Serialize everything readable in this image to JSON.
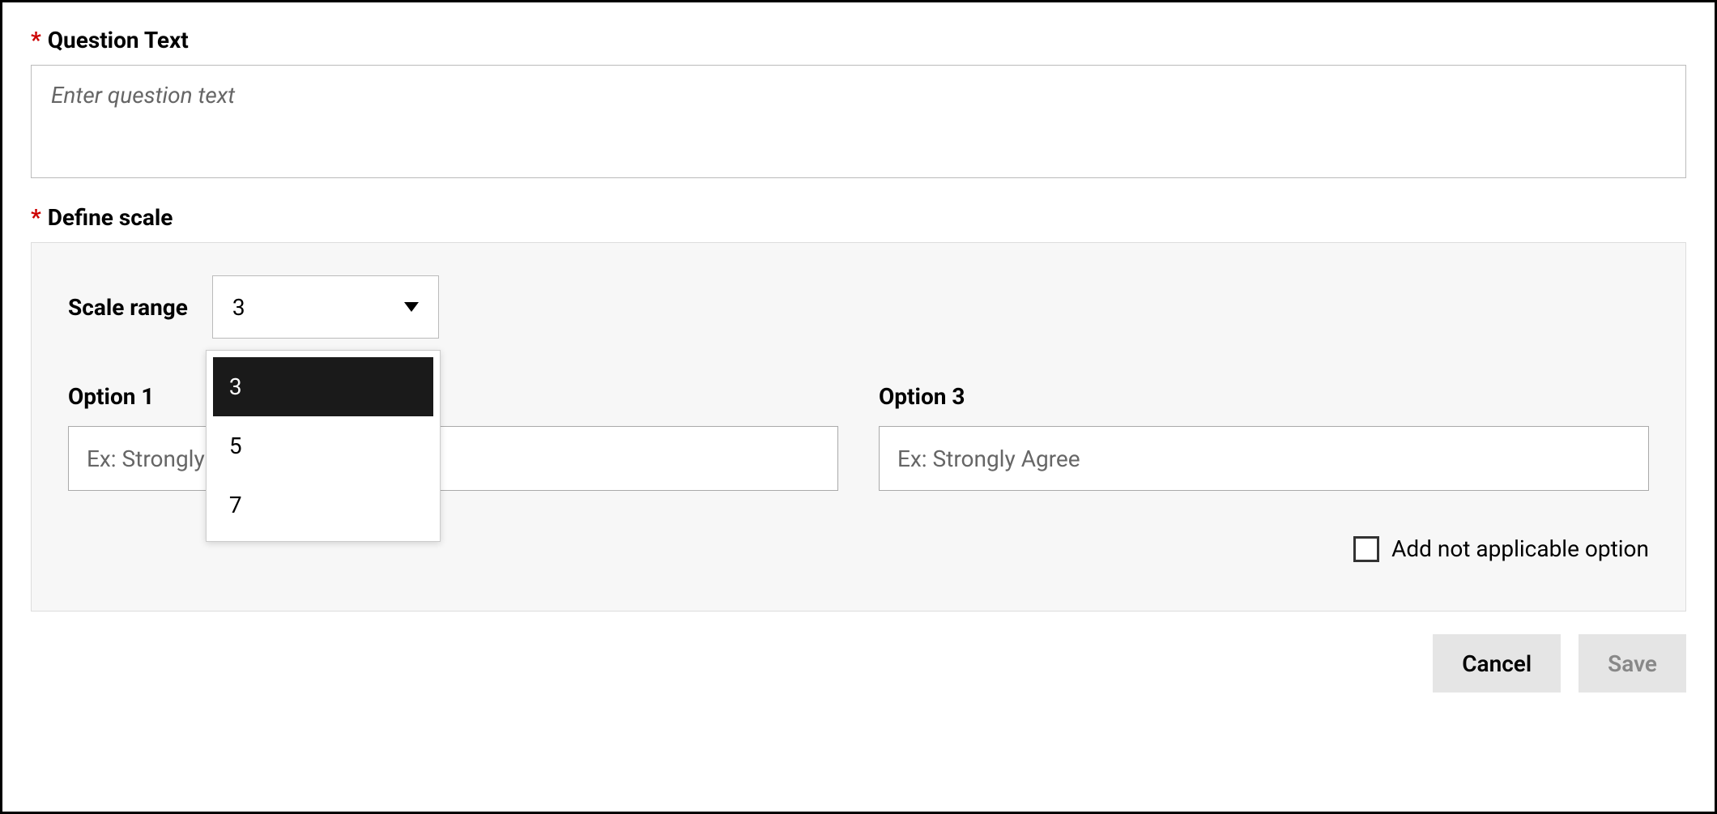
{
  "question_text": {
    "label": "Question Text",
    "placeholder": "Enter question text",
    "value": ""
  },
  "define_scale": {
    "label": "Define scale",
    "scale_range_label": "Scale range",
    "scale_range_value": "3",
    "scale_range_options": [
      "3",
      "5",
      "7"
    ],
    "option1": {
      "label": "Option 1",
      "placeholder": "Ex: Strongly Disagree",
      "value": ""
    },
    "option3": {
      "label": "Option 3",
      "placeholder": "Ex: Strongly Agree",
      "value": ""
    },
    "not_applicable_label": "Add not applicable option",
    "not_applicable_checked": false
  },
  "buttons": {
    "cancel": "Cancel",
    "save": "Save"
  }
}
